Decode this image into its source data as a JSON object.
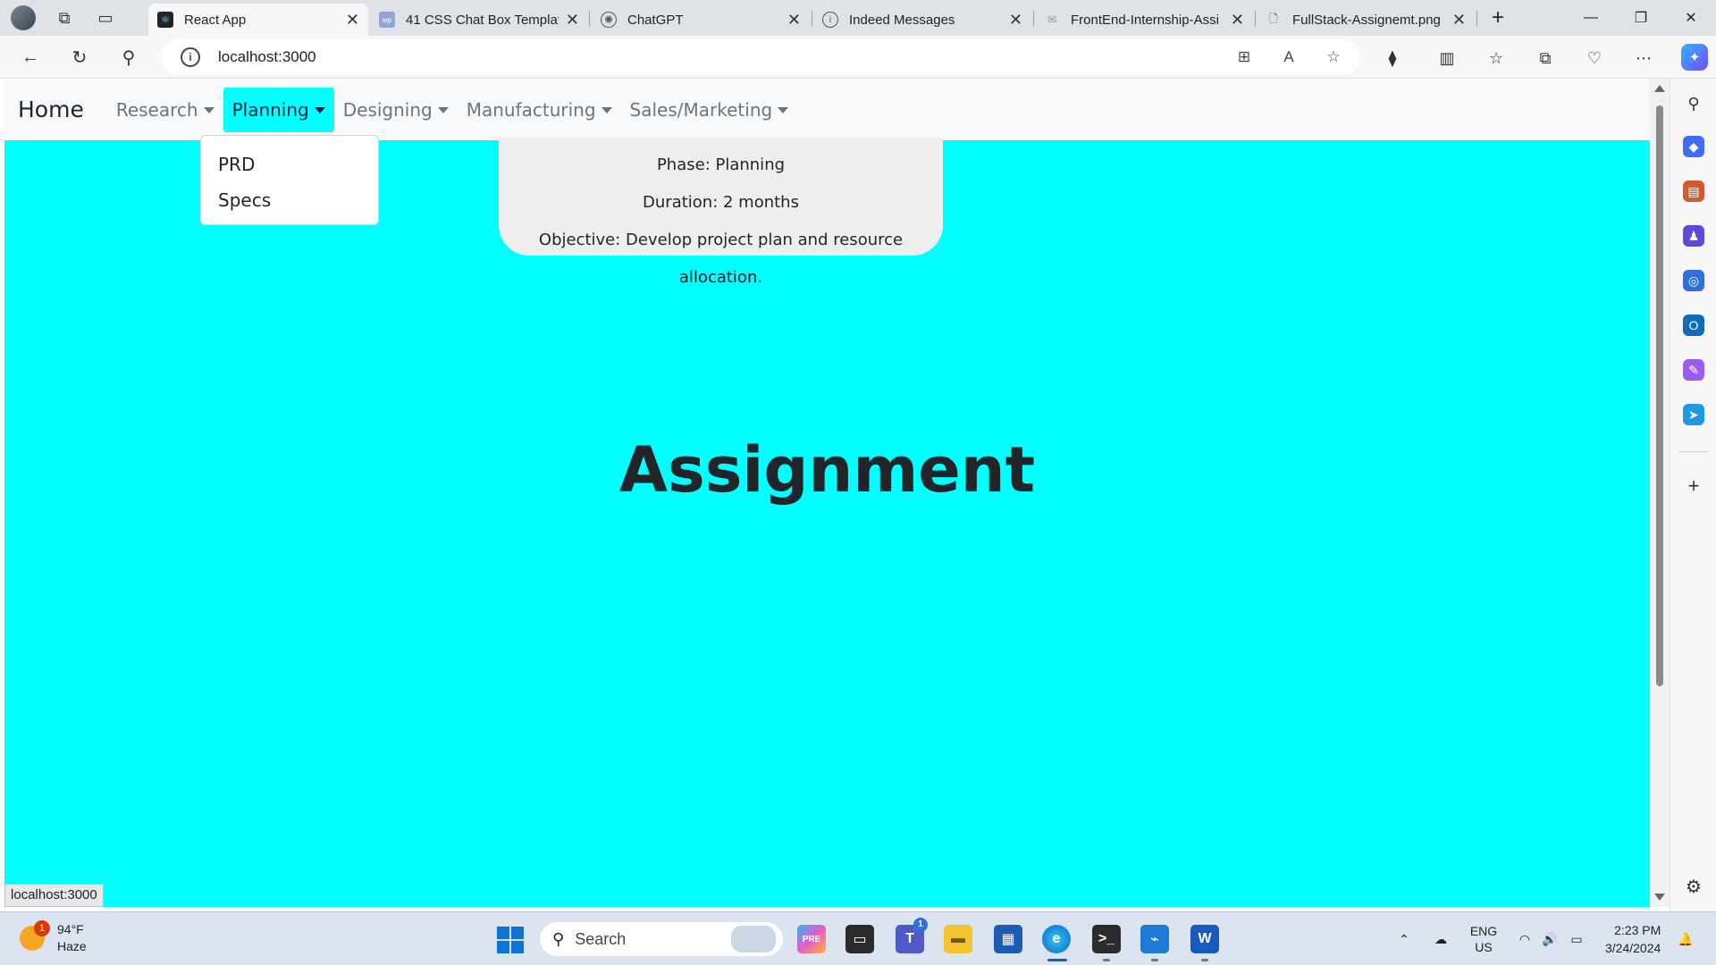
{
  "browser": {
    "tabs": [
      {
        "title": "React App",
        "active": true
      },
      {
        "title": "41 CSS Chat Box Templat",
        "active": false
      },
      {
        "title": "ChatGPT",
        "active": false
      },
      {
        "title": "Indeed Messages",
        "active": false
      },
      {
        "title": "FrontEnd-Internship-Assi",
        "active": false
      },
      {
        "title": "FullStack-Assignemt.png",
        "active": false
      }
    ],
    "address": "localhost:3000",
    "status_url": "localhost:3000"
  },
  "app": {
    "brand": "Home",
    "nav": [
      {
        "label": "Research",
        "active": false
      },
      {
        "label": "Planning",
        "active": true
      },
      {
        "label": "Designing",
        "active": false
      },
      {
        "label": "Manufacturing",
        "active": false
      },
      {
        "label": "Sales/Marketing",
        "active": false
      }
    ],
    "dropdown": [
      "PRD",
      "Specs"
    ],
    "phase_card": {
      "phase": "Phase: Planning",
      "duration": "Duration: 2 months",
      "objective": "Objective: Develop project plan and resource allocation."
    },
    "heading": "Assignment",
    "background_color": "#00ffff"
  },
  "taskbar": {
    "weather_temp": "94°F",
    "weather_desc": "Haze",
    "weather_badge": "1",
    "search_placeholder": "Search",
    "teams_badge": "1",
    "lang_top": "ENG",
    "lang_bottom": "US",
    "time": "2:23 PM",
    "date": "3/24/2024"
  }
}
